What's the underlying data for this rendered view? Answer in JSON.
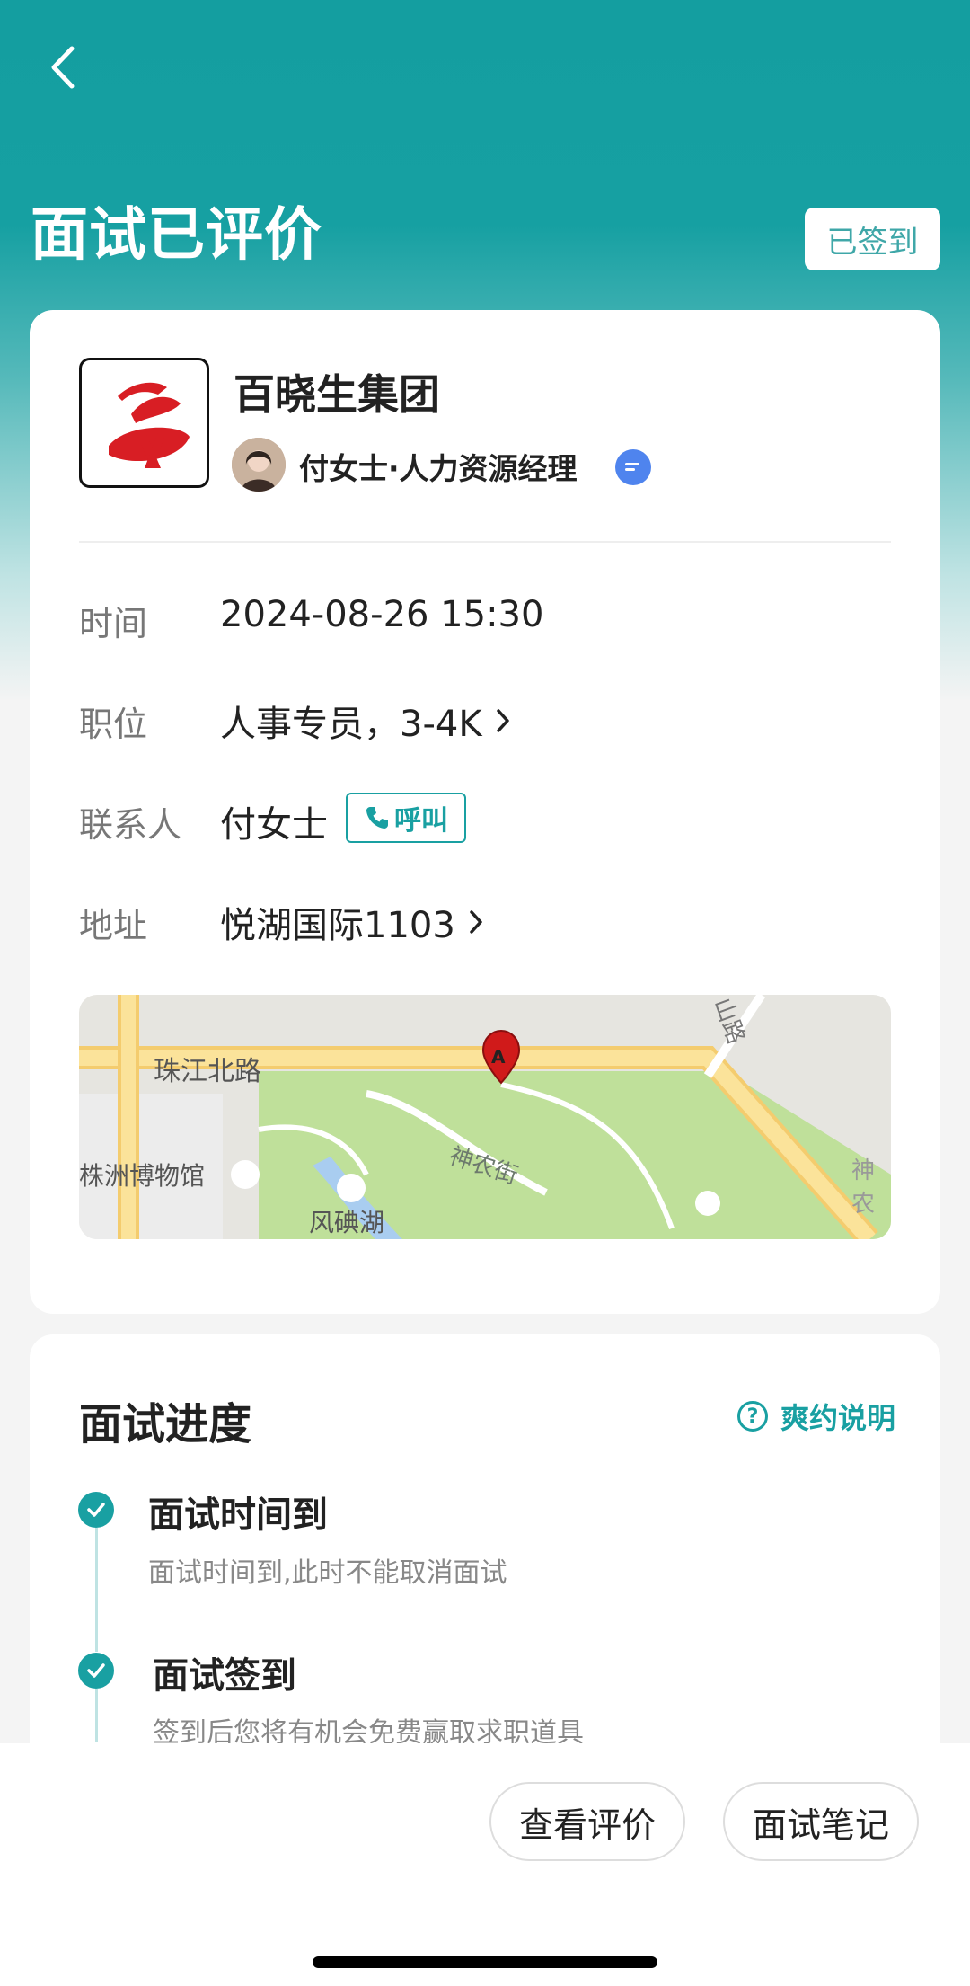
{
  "header": {
    "title": "面试已评价",
    "status_badge": "已签到"
  },
  "company": {
    "name": "百晓生集团",
    "recruiter": "付女士·人力资源经理"
  },
  "details": {
    "time_label": "时间",
    "time_value": "2024-08-26 15:30",
    "position_label": "职位",
    "position_value": "人事专员，3-4K",
    "contact_label": "联系人",
    "contact_value": "付女士",
    "call_label": "呼叫",
    "address_label": "地址",
    "address_value": "悦湖国际1103"
  },
  "map": {
    "labels": {
      "road": "珠江北路",
      "museum": "株洲博物馆",
      "street": "神农街",
      "lake": "风碘湖",
      "mountain_road": "山路",
      "shen": "神农"
    },
    "pin_letter": "A"
  },
  "progress": {
    "title": "面试进度",
    "help_label": "爽约说明",
    "steps": [
      {
        "title": "面试时间到",
        "desc": "面试时间到,此时不能取消面试"
      },
      {
        "title": "面试签到",
        "desc": "签到后您将有机会免费赢取求职道具"
      }
    ]
  },
  "actions": {
    "view_review": "查看评价",
    "notes": "面试笔记"
  },
  "colors": {
    "accent": "#19a0a2",
    "header": "#149ea0"
  }
}
